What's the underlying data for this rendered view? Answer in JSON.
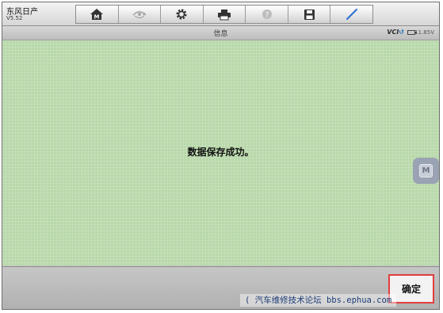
{
  "app": {
    "brand_name": "东风日产",
    "version": "V5.52"
  },
  "toolbar": {
    "icons": [
      "home-icon",
      "vehicle-swap-icon",
      "settings-gear-icon",
      "print-icon",
      "help-icon",
      "save-icon",
      "pen-icon"
    ]
  },
  "header": {
    "title": "信息",
    "vci_text": "VCI",
    "voltage": "11.85V"
  },
  "dialog": {
    "message": "数据保存成功。",
    "ok_label": "确定"
  },
  "floating": {
    "label": "M"
  },
  "watermark": {
    "text": "( 汽车维修技术论坛 bbs.ephua.com"
  }
}
